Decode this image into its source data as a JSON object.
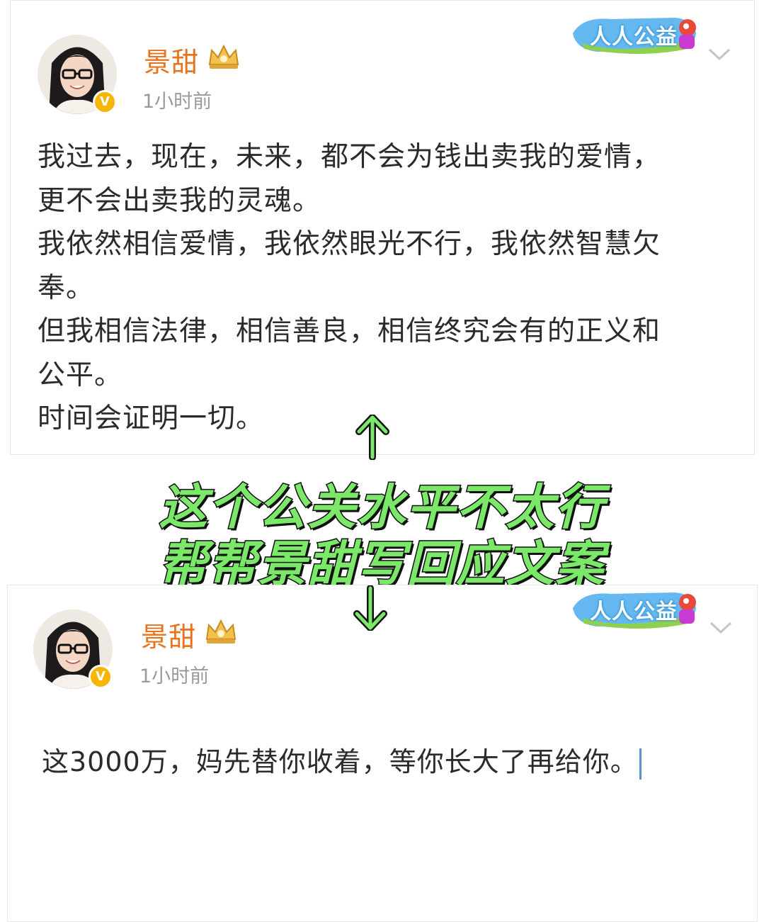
{
  "post1": {
    "username": "景甜",
    "time": "1小时前",
    "charity_badge": "人人公益",
    "verified_badge": "V",
    "paragraphs": [
      "我过去，现在，未来，都不会为钱出卖我的爱情，",
      "更不会出卖我的灵魂。",
      "我依然相信爱情，我依然眼光不行，我依然智慧欠",
      "奉。",
      "但我相信法律，相信善良，相信终究会有的正义和",
      "公平。",
      "时间会证明一切。"
    ]
  },
  "overlay": {
    "line1": "这个公关水平不太行",
    "line2": "帮帮景甜写回应文案"
  },
  "post2": {
    "username": "景甜",
    "time": "1小时前",
    "charity_badge": "人人公益",
    "verified_badge": "V",
    "text": "这3000万，妈先替你收着，等你长大了再给你。"
  },
  "colors": {
    "username": "#e8731e",
    "overlay_text": "#7be86a",
    "verified": "#f7b500"
  },
  "icons": [
    "crown-icon",
    "chevron-down-icon",
    "verified-icon",
    "arrow-up-icon",
    "arrow-down-icon"
  ]
}
